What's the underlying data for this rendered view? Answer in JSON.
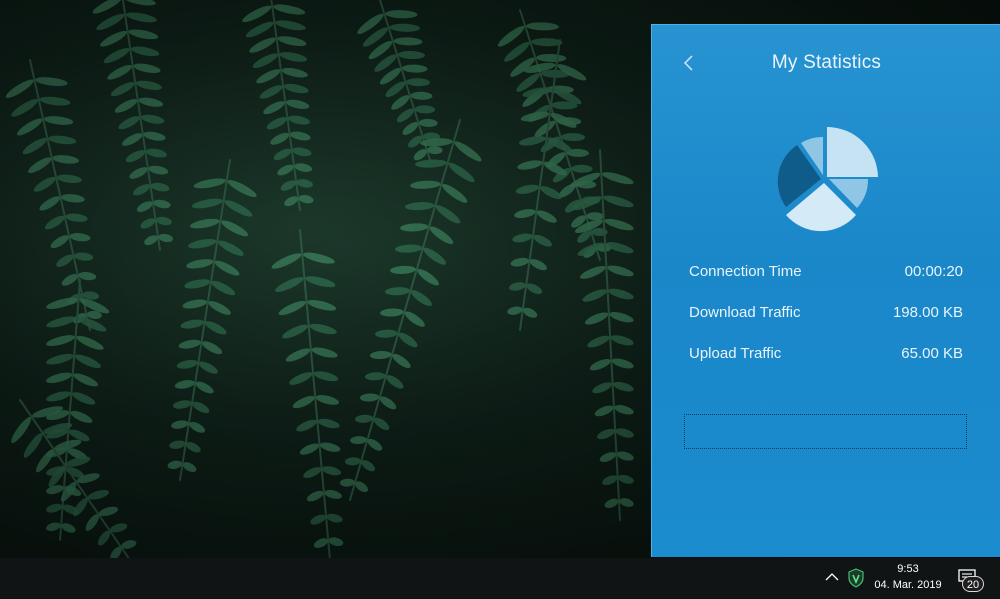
{
  "panel": {
    "title": "My Statistics",
    "stats": [
      {
        "label": "Connection Time",
        "value": "00:00:20"
      },
      {
        "label": "Download Traffic",
        "value": "198.00 KB"
      },
      {
        "label": "Upload Traffic",
        "value": "65.00 KB"
      }
    ],
    "icons": {
      "back": "chevron-left-icon",
      "chart": "pie-chart-icon"
    },
    "colors": {
      "panel_bg": "#1a87c9",
      "pie_light": "#c6e3f3",
      "pie_dark": "#0f5c8a"
    }
  },
  "taskbar": {
    "clock_time": "9:53",
    "clock_date": "04. Mar. 2019",
    "notification_count": "20"
  }
}
